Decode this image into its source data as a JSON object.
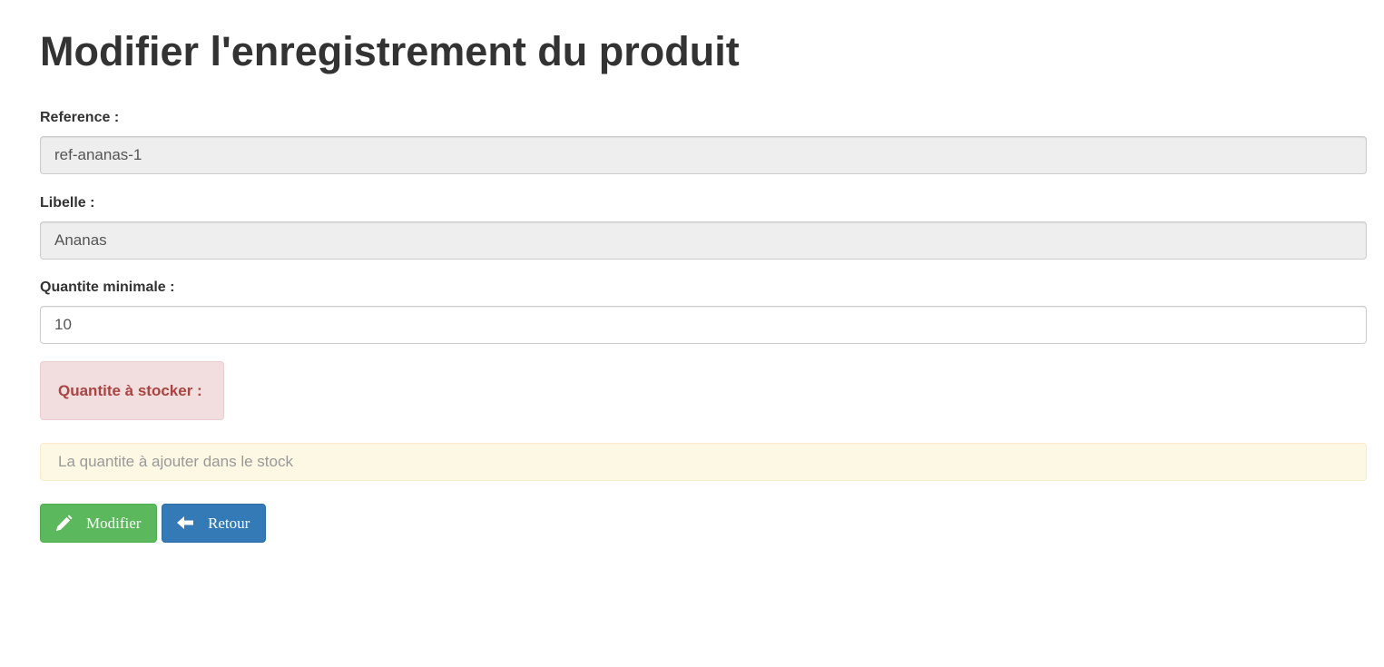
{
  "page": {
    "title": "Modifier l'enregistrement du produit"
  },
  "form": {
    "reference": {
      "label": "Reference :",
      "value": "ref-ananas-1"
    },
    "libelle": {
      "label": "Libelle :",
      "value": "Ananas"
    },
    "quantite_minimale": {
      "label": "Quantite minimale :",
      "value": "10"
    },
    "quantite_a_stocker": {
      "label": "Quantite à stocker :",
      "placeholder": "La quantite à ajouter dans le stock"
    }
  },
  "actions": {
    "modifier": {
      "label": "Modifier",
      "icon": "pencil-icon"
    },
    "retour": {
      "label": "Retour",
      "icon": "arrow-left-icon"
    }
  },
  "colors": {
    "success": "#5cb85c",
    "primary": "#337ab7",
    "danger_text": "#a94442",
    "danger_bg": "#f2dede",
    "warning_bg": "#fcf8e3"
  }
}
